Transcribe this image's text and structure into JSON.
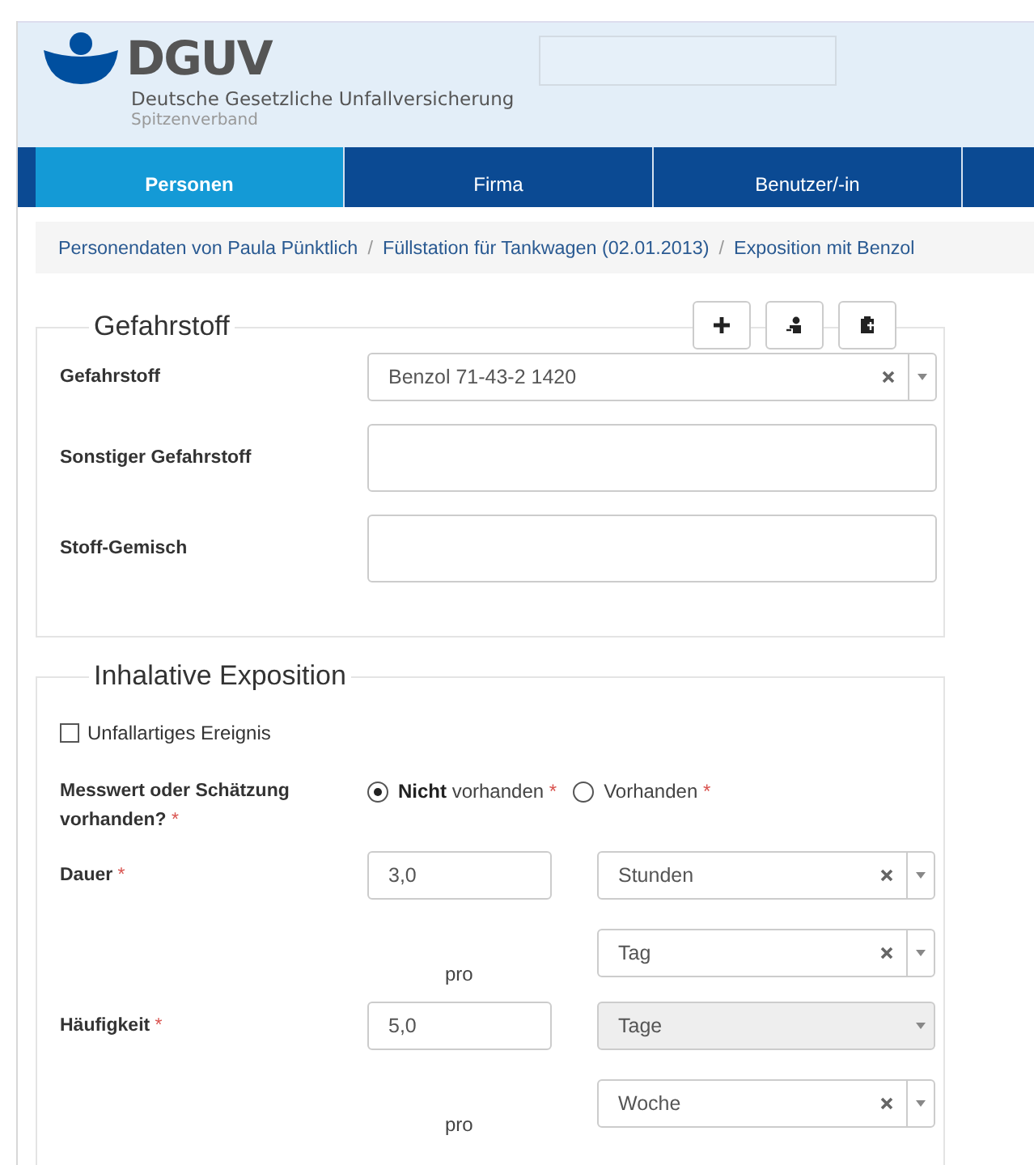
{
  "header": {
    "logo_text": "DGUV",
    "org_name": "Deutsche Gesetzliche Unfallversicherung",
    "org_sub": "Spitzenverband"
  },
  "tabs": [
    {
      "label": "Personen",
      "selected": true
    },
    {
      "label": "Firma",
      "selected": false
    },
    {
      "label": "Benutzer/-in",
      "selected": false
    }
  ],
  "breadcrumb": [
    {
      "label": "Personendaten von Paula Pünktlich",
      "separator": "/"
    },
    {
      "label": "Füllstation für Tankwagen (02.01.2013)",
      "separator": "/"
    },
    {
      "label": "Exposition mit Benzol"
    }
  ],
  "gefahrstoff": {
    "legend": "Gefahrstoff",
    "toolbar": [
      {
        "kind": "plus"
      },
      {
        "kind": "person"
      },
      {
        "kind": "clipboard"
      }
    ],
    "rows": [
      {
        "label": "Gefahrstoff",
        "kind": "select",
        "value": "Benzol 71-43-2 1420"
      },
      {
        "label": "Sonstiger Gefahrstoff",
        "kind": "text"
      },
      {
        "label": "Stoff-Gemisch",
        "kind": "text"
      }
    ]
  },
  "inhalative": {
    "legend": "Inhalative Exposition",
    "checkbox": {
      "label": "Unfallartiges Ereignis",
      "checked": false
    },
    "measure": {
      "label": "Messwert oder Schätzung vorhanden?",
      "required_mark": "*",
      "options": [
        {
          "label": "**Nicht** vorhanden",
          "selected": true,
          "required_mark": "*"
        },
        {
          "label": "Vorhanden",
          "selected": false,
          "required_mark": "*"
        }
      ]
    },
    "rows": [
      {
        "label": "Dauer",
        "required_mark": "*",
        "value": "3,0",
        "unit": {
          "value": "Stunden",
          "disabled": false
        },
        "per_label": "pro",
        "per": {
          "value": "Tag",
          "disabled": false
        }
      },
      {
        "label": "Häufigkeit",
        "required_mark": "*",
        "value": "5,0",
        "unit": {
          "value": "Tage",
          "disabled": true
        },
        "per_label": "pro",
        "per": {
          "value": "Woche",
          "disabled": false
        }
      }
    ]
  }
}
